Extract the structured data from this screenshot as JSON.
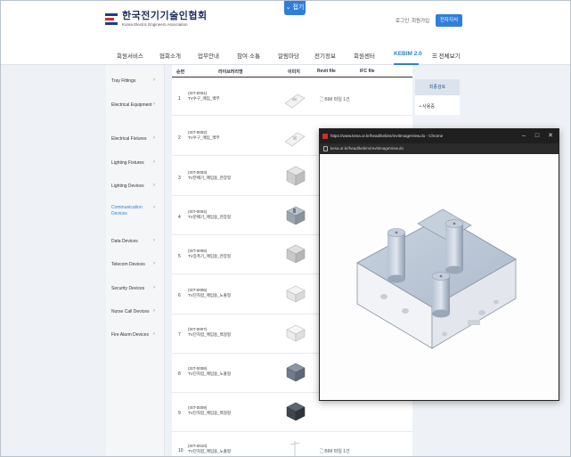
{
  "top_tab": {
    "label": "접기"
  },
  "header": {
    "logo_kr": "한국전기기술인협회",
    "logo_en": "Korea Electric Engineers Association",
    "util": [
      "로그인",
      "회원가입"
    ],
    "util_button": "전자지식",
    "nav": [
      "회원서비스",
      "협회소개",
      "업무안내",
      "참여·소통",
      "알림마당",
      "전기정보",
      "회원센터",
      "KEBIM 2.0",
      "전체보기"
    ],
    "active_nav": "KEBIM 2.0"
  },
  "sidebar": {
    "items": [
      "Tray Fittings",
      "Electrical Equipment",
      "Electrical Fixtures",
      "Lighting Fixtures",
      "Lighting Devices",
      "Communication Devices",
      "Data Devices",
      "Telecom Devices",
      "Security Devices",
      "Nurse Call Devices",
      "Fire Alarm Devices"
    ],
    "active": "Communication Devices"
  },
  "table": {
    "headers": {
      "num": "순번",
      "library": "라이브러리명",
      "image": "이미지",
      "revit": "Revit file",
      "ifc": "IFC file"
    },
    "rows": [
      {
        "num": "1",
        "code": "(IST-0001)",
        "name": "TV수구_매입_벽부"
      },
      {
        "num": "2",
        "code": "(IST-0002)",
        "name": "TV수구_매입_벽부"
      },
      {
        "num": "3",
        "code": "(IST-0003)",
        "name": "TV분배기_매입용_천장형"
      },
      {
        "num": "4",
        "code": "(IST-0004)",
        "name": "TV분배기_매입용_천장형"
      },
      {
        "num": "5",
        "code": "(IST-0005)",
        "name": "TV증폭기_매입용_천장형"
      },
      {
        "num": "6",
        "code": "(IST-0006)",
        "name": "TV단자함_매입용_노출형"
      },
      {
        "num": "7",
        "code": "(IST-0007)",
        "name": "TV단자함_매입용_벽걸형"
      },
      {
        "num": "8",
        "code": "(IST-0008)",
        "name": "TV단자함_매입용_노출형"
      },
      {
        "num": "9",
        "code": "(IST-0009)",
        "name": "TV단자함_매입용_벽걸형"
      },
      {
        "num": "10",
        "code": "(IST-0010)",
        "name": "TV단자함_매입용_노출형"
      }
    ],
    "revit_label_1": "BIM 파일 1건",
    "revit_label_10": "BIM 파일 1건"
  },
  "right_panel": {
    "head": "최종검토",
    "item": "사용중"
  },
  "popup": {
    "title": "https://www.kesa.or.kr/head/kebim/revitImageView.do - Chrome",
    "url": "kesa.or.kr/head/kebim/revitImageView.do",
    "controls": [
      "–",
      "□",
      "✕"
    ]
  }
}
